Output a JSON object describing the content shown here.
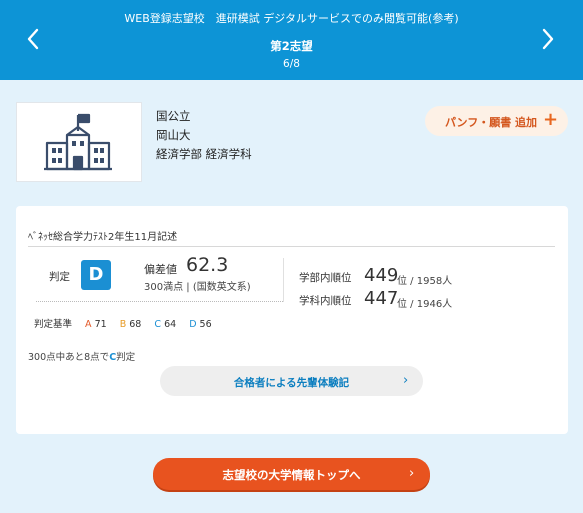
{
  "header": {
    "subtitle": "WEB登録志望校　進研模試 デジタルサービスでのみ閲覧可能(参考)",
    "title": "第2志望",
    "page": "6/8",
    "prev_icon": "chevron-left-icon",
    "next_icon": "chevron-right-icon"
  },
  "school": {
    "type": "国公立",
    "name": "岡山大",
    "department": "経済学部 経済学科",
    "image_icon": "school-building-icon"
  },
  "pamphlet_button": {
    "label": "パンフ・願書 追加",
    "icon": "+"
  },
  "result": {
    "test_name": "ﾍﾞﾈｯｾ総合学力ﾃｽﾄ2年生11月記述",
    "judgement_label": "判定",
    "grade": "D",
    "hensachi_label": "偏差値",
    "hensachi_value": "62.3",
    "manten_note": "300満点 | (国数英文系)",
    "faculty_rank": {
      "label": "学部内順位",
      "rank": "449",
      "unit": "位 / 1958人"
    },
    "department_rank": {
      "label": "学科内順位",
      "rank": "447",
      "unit": "位 / 1946人"
    },
    "criteria": {
      "label": "判定基準",
      "items": [
        {
          "grade": "A",
          "value": "71"
        },
        {
          "grade": "B",
          "value": "68"
        },
        {
          "grade": "C",
          "value": "64"
        },
        {
          "grade": "D",
          "value": "56"
        }
      ]
    },
    "points_note_prefix": "300点中あと8点で",
    "points_note_grade": "C",
    "points_note_suffix": "判定"
  },
  "experience_button": {
    "label": "合格者による先輩体験記",
    "arrow": "›"
  },
  "top_button": {
    "label": "志望校の大学情報トップへ",
    "arrow": "›"
  },
  "colors": {
    "header": "#0d94d6",
    "background": "#e3f2fb",
    "grade_badge": "#1b8fd3",
    "accent_orange": "#e8531f"
  }
}
